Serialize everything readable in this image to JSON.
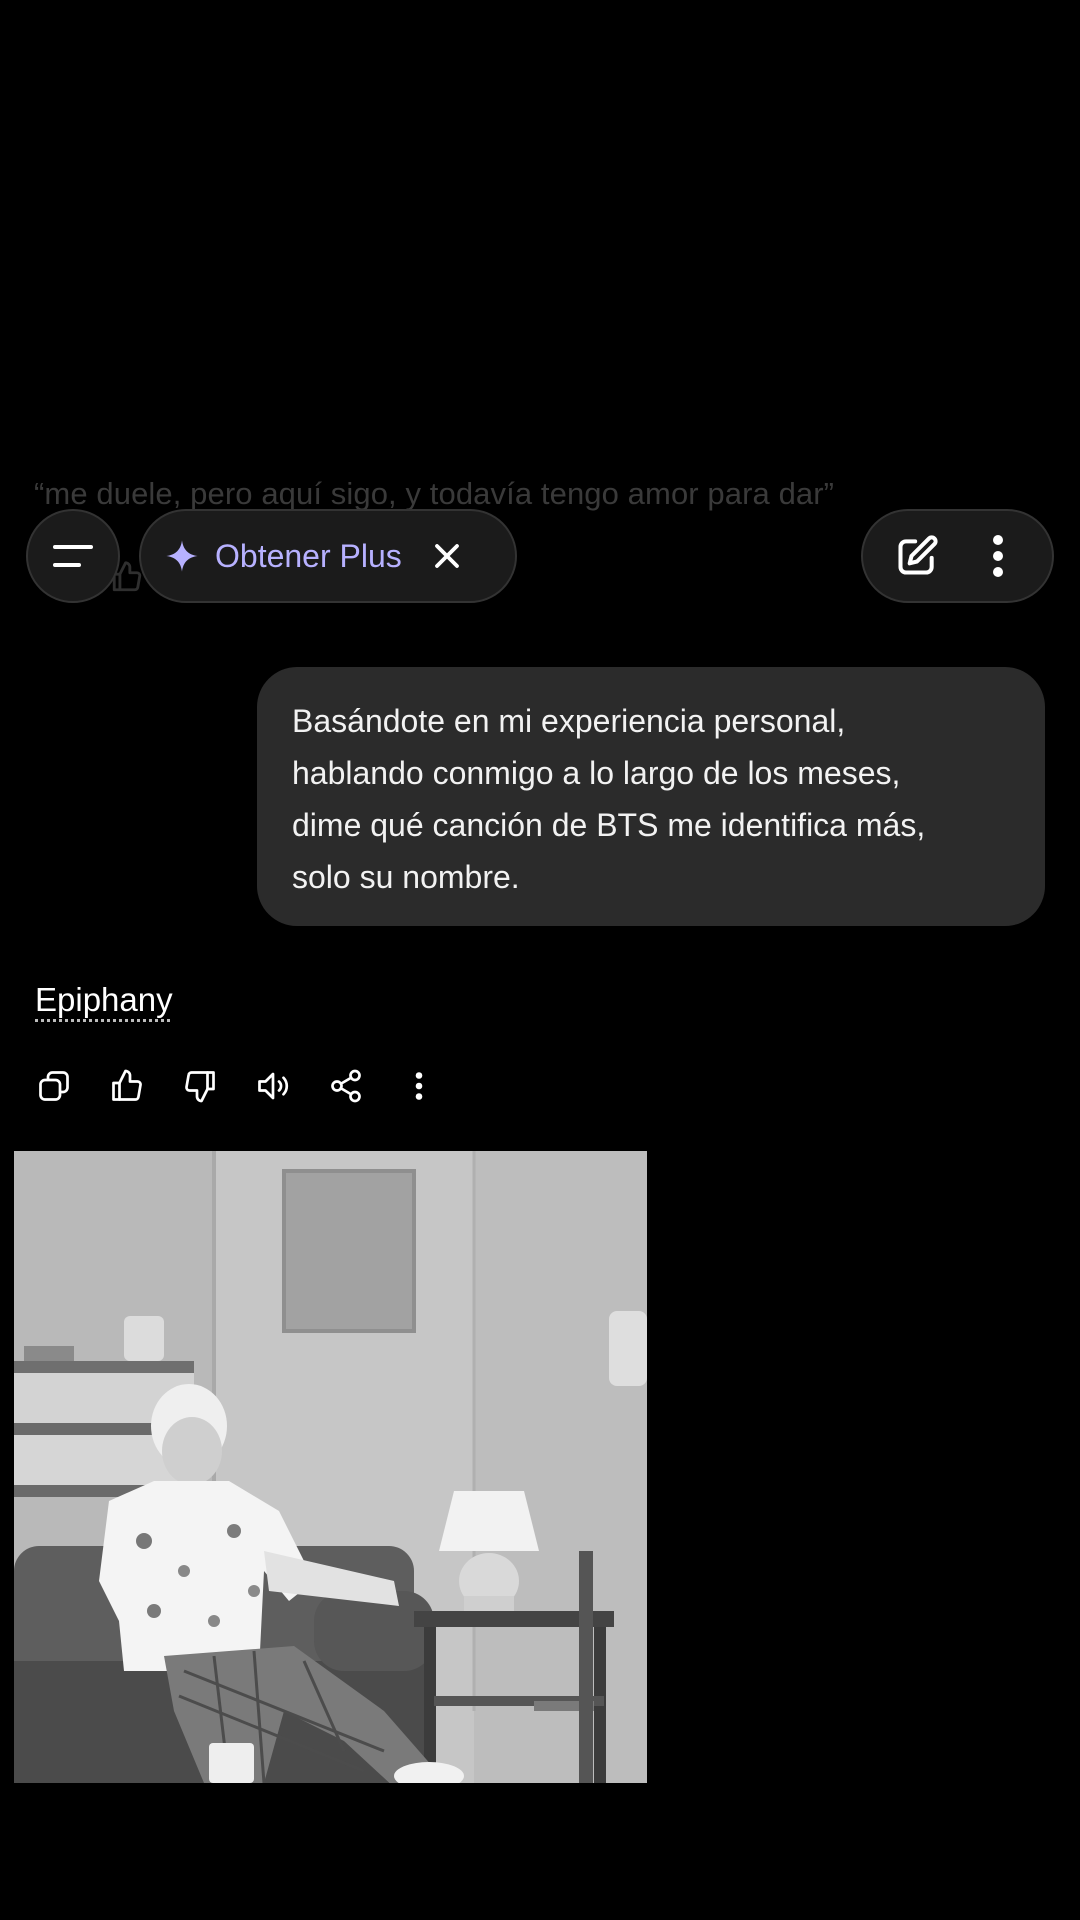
{
  "previous_message": {
    "quote": "“me duele, pero aquí sigo, y todavía tengo amor para dar”"
  },
  "top_bar": {
    "menu_icon": "menu-icon",
    "plus_label": "Obtener Plus",
    "plus_icon": "sparkle-icon",
    "close_icon": "close-icon",
    "new_chat_icon": "edit-icon",
    "more_icon": "more-vertical-icon"
  },
  "conversation": {
    "user_message_lines": [
      "Basándote en mi experiencia personal,",
      "hablando conmigo a lo largo de los meses,",
      "dime qué canción de BTS me identifica más,",
      "solo su nombre."
    ],
    "assistant_reply": "Epiphany"
  },
  "actions": [
    {
      "icon": "copy-icon"
    },
    {
      "icon": "thumbs-up-icon"
    },
    {
      "icon": "thumbs-down-icon"
    },
    {
      "icon": "read-aloud-icon"
    },
    {
      "icon": "share-icon"
    },
    {
      "icon": "more-vertical-icon"
    }
  ],
  "photo": {
    "description_icon": "photo-icon"
  },
  "colors": {
    "background": "#000000",
    "bubble": "#2b2b2b",
    "pill_background": "#1b1b1b",
    "accent": "#b7b1ff"
  }
}
